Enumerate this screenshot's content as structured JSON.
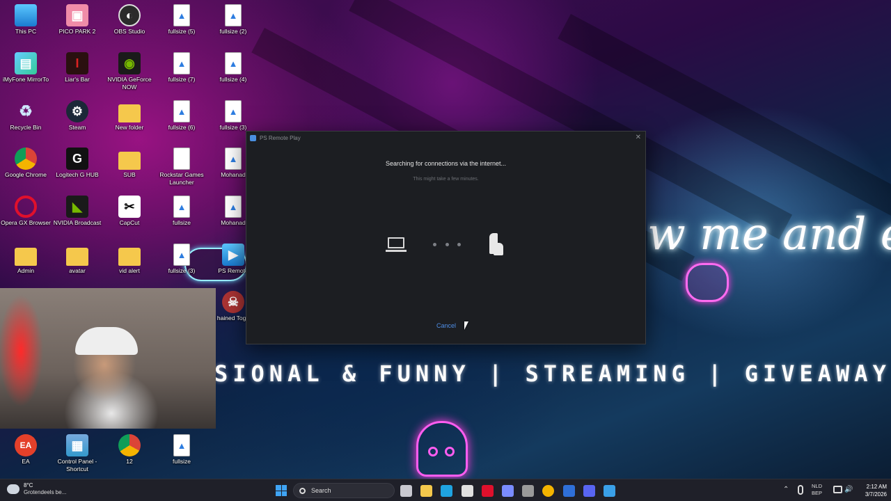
{
  "desktop_icons": [
    {
      "label": "This PC",
      "glyph": "",
      "style": "g-pc",
      "icon": "this-pc-icon"
    },
    {
      "label": "PICO PARK 2",
      "glyph": "▣",
      "style": "g-pico",
      "icon": "pico-park-icon"
    },
    {
      "label": "OBS Studio",
      "glyph": "◐",
      "style": "g-obs",
      "icon": "obs-icon"
    },
    {
      "label": "fullsize (5)",
      "glyph": "▲",
      "style": "g-file",
      "icon": "image-file-icon"
    },
    {
      "label": "fullsize (2)",
      "glyph": "▲",
      "style": "g-file",
      "icon": "image-file-icon"
    },
    {
      "label": "iMyFone MirrorTo",
      "glyph": "▤",
      "style": "g-imy",
      "icon": "imyfone-icon"
    },
    {
      "label": "Liar's Bar",
      "glyph": "I",
      "style": "g-liar",
      "icon": "liars-bar-icon"
    },
    {
      "label": "NVIDIA GeForce NOW",
      "glyph": "◉",
      "style": "g-nv",
      "icon": "nvidia-icon"
    },
    {
      "label": "fullsize (7)",
      "glyph": "▲",
      "style": "g-file",
      "icon": "image-file-icon"
    },
    {
      "label": "fullsize (4)",
      "glyph": "▲",
      "style": "g-file",
      "icon": "image-file-icon"
    },
    {
      "label": "Recycle Bin",
      "glyph": "♻",
      "style": "g-bin",
      "icon": "recycle-bin-icon"
    },
    {
      "label": "Steam",
      "glyph": "⚙",
      "style": "g-steam",
      "icon": "steam-icon"
    },
    {
      "label": "New folder",
      "glyph": "",
      "style": "g-folder",
      "icon": "folder-icon"
    },
    {
      "label": "fullsize (6)",
      "glyph": "▲",
      "style": "g-file",
      "icon": "image-file-icon"
    },
    {
      "label": "fullsize (3)",
      "glyph": "▲",
      "style": "g-file",
      "icon": "image-file-icon"
    },
    {
      "label": "Google Chrome",
      "glyph": "",
      "style": "g-chrome",
      "icon": "chrome-icon"
    },
    {
      "label": "Logitech G HUB",
      "glyph": "G",
      "style": "g-logi",
      "icon": "logitech-icon"
    },
    {
      "label": "SUB",
      "glyph": "",
      "style": "g-folder",
      "icon": "folder-icon"
    },
    {
      "label": "Rockstar Games Launcher",
      "glyph": "",
      "style": "g-file",
      "icon": "file-icon"
    },
    {
      "label": "Mohanad",
      "glyph": "▲",
      "style": "g-file",
      "icon": "image-file-icon"
    },
    {
      "label": "Opera GX Browser",
      "glyph": "",
      "style": "g-opera",
      "icon": "opera-icon"
    },
    {
      "label": "NVIDIA Broadcast",
      "glyph": "◣",
      "style": "g-nv",
      "icon": "nvidia-broadcast-icon"
    },
    {
      "label": "CapCut",
      "glyph": "✂",
      "style": "g-capcut",
      "icon": "capcut-icon"
    },
    {
      "label": "fullsize",
      "glyph": "▲",
      "style": "g-file",
      "icon": "image-file-icon"
    },
    {
      "label": "Mohanad",
      "glyph": "▲",
      "style": "g-file",
      "icon": "image-file-icon"
    },
    {
      "label": "Admin",
      "glyph": "",
      "style": "g-folder",
      "icon": "folder-icon"
    },
    {
      "label": "avatar",
      "glyph": "",
      "style": "g-folder",
      "icon": "folder-icon"
    },
    {
      "label": "vid alert",
      "glyph": "",
      "style": "g-folder",
      "icon": "folder-icon"
    },
    {
      "label": "fullsize (3)",
      "glyph": "▲",
      "style": "g-file",
      "icon": "image-file-icon"
    },
    {
      "label": "PS Remote",
      "glyph": "▶",
      "style": "g-pc",
      "icon": "ps-remote-icon"
    },
    {
      "label": "hained Toge",
      "glyph": "☠",
      "style": "g-chained",
      "icon": "chained-together-icon"
    },
    {
      "label": "EA",
      "glyph": "EA",
      "style": "g-ea",
      "icon": "ea-icon"
    },
    {
      "label": "Control Panel - Shortcut",
      "glyph": "▦",
      "style": "g-cp",
      "icon": "control-panel-icon"
    },
    {
      "label": "12",
      "glyph": "",
      "style": "g-chrome",
      "icon": "chrome-icon"
    },
    {
      "label": "fullsize",
      "glyph": "▲",
      "style": "g-file",
      "icon": "image-file-icon"
    }
  ],
  "wallpaper": {
    "neon_text": "w me and en",
    "banner": "SIONAL & FUNNY | STREAMING | GIVEAWAY"
  },
  "dialog": {
    "title": "PS Remote Play",
    "heading": "Searching for connections via the internet...",
    "subtext": "This might take a few minutes.",
    "cancel_label": "Cancel",
    "close_glyph": "✕"
  },
  "taskbar": {
    "weather_temp": "8°C",
    "weather_desc": "Grotendeels be...",
    "search_placeholder": "Search",
    "apps": [
      {
        "name": "task-view-icon",
        "color": "#c8c8d0"
      },
      {
        "name": "file-explorer-icon",
        "color": "#f5c84c"
      },
      {
        "name": "edge-icon",
        "color": "#1fa3e0"
      },
      {
        "name": "store-icon",
        "color": "#e0e0e0"
      },
      {
        "name": "opera-gx-icon",
        "color": "#e0102c"
      },
      {
        "name": "app-icon",
        "color": "#7a8cff"
      },
      {
        "name": "obs-icon",
        "color": "#9a9a9a"
      },
      {
        "name": "chrome-icon",
        "color": "#f4b400"
      },
      {
        "name": "ps-remote-play-icon",
        "color": "#2f6fd8"
      },
      {
        "name": "discord-icon",
        "color": "#5865f2"
      },
      {
        "name": "mail-icon",
        "color": "#3aa0e8"
      }
    ],
    "lang_line1": "NLD",
    "lang_line2": "BEP",
    "time": "2:12 AM",
    "date": "3/7/2026",
    "chevron": "⌃",
    "volume_glyph": "🔊"
  }
}
